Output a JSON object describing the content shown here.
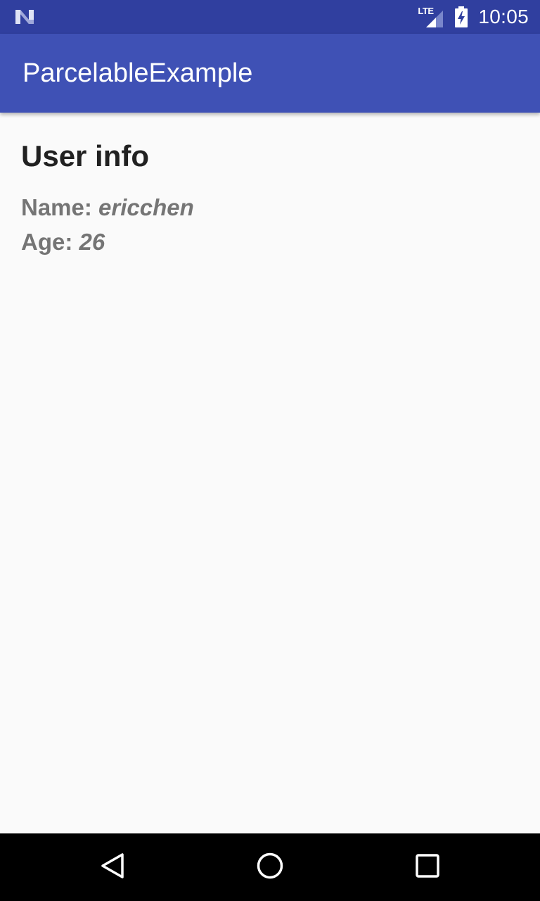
{
  "status_bar": {
    "left_icon": "n-logo-icon",
    "network_label": "LTE",
    "signal_icon": "signal-icon",
    "battery_icon": "battery-charging-icon",
    "time": "10:05"
  },
  "app_bar": {
    "title": "ParcelableExample"
  },
  "content": {
    "heading": "User info",
    "name_label": "Name: ",
    "name_value": "ericchen",
    "age_label": "Age: ",
    "age_value": "26"
  },
  "nav_bar": {
    "back_icon": "back-triangle-icon",
    "home_icon": "home-circle-icon",
    "recents_icon": "recents-square-icon"
  },
  "colors": {
    "status_bar": "#303f9f",
    "app_bar": "#3f51b5",
    "background": "#fafafa",
    "heading_text": "#212121",
    "secondary_text": "#757575",
    "nav_bar": "#000000"
  }
}
